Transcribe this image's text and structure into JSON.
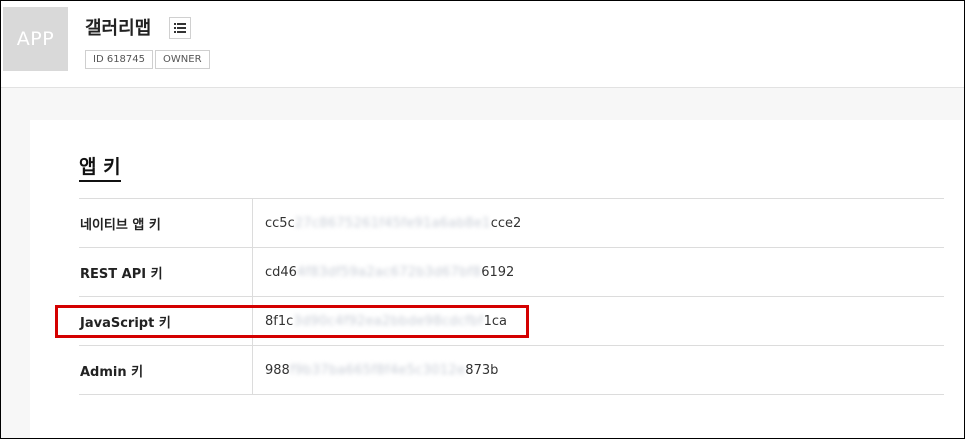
{
  "app": {
    "thumb_label": "APP",
    "name": "갤러리맵",
    "menu_icon": "list-icon",
    "tags": [
      "ID 618745",
      "OWNER"
    ]
  },
  "section": {
    "title": "앱 키"
  },
  "keys": [
    {
      "label": "네이티브 앱 키",
      "prefix": "cc5c",
      "masked": "27c8675261f45fe91a6ab8e1",
      "suffix": "cce2"
    },
    {
      "label": "REST API 키",
      "prefix": "cd46",
      "masked": "4f83df59a2ac672b3d67bf8",
      "suffix": "6192"
    },
    {
      "label": "JavaScript 키",
      "prefix": "8f1c",
      "masked": "3d90c4f92ea2bbde98cdcfbf",
      "suffix": "1ca"
    },
    {
      "label": "Admin 키",
      "prefix": "988",
      "masked": "f9b37ba665f8f4e5c3012e",
      "suffix": "873b"
    }
  ],
  "colors": {
    "highlight": "#d40000",
    "thumb_bg": "#d9d9d9"
  }
}
